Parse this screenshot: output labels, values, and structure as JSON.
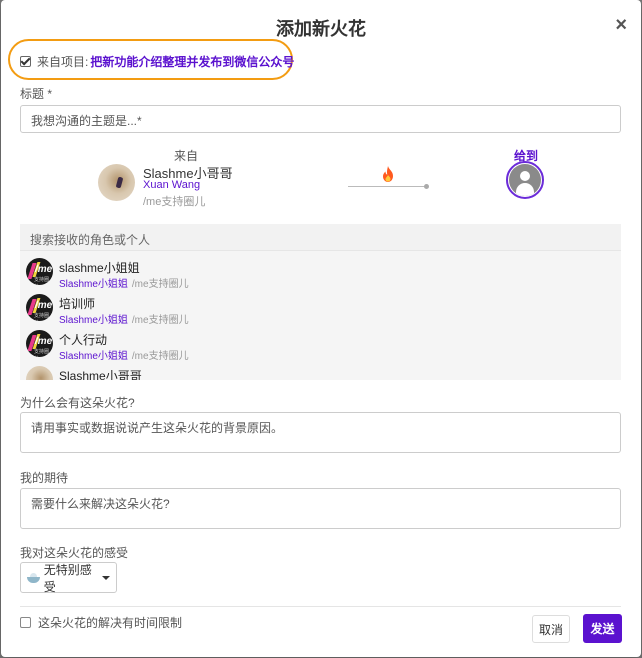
{
  "modal": {
    "title": "添加新火花",
    "close_glyph": "×"
  },
  "from_project": {
    "checked": true,
    "label": "来自项目:",
    "project_name": "把新功能介绍整理并发布到微信公众号"
  },
  "title_field": {
    "label": "标题 *",
    "placeholder": "我想沟通的主题是...*"
  },
  "sender": {
    "header": "来自",
    "name": "Slashme小哥哥",
    "user": "Xuan Wang",
    "circle": "/me支持圈儿"
  },
  "recipient": {
    "header": "给到"
  },
  "search": {
    "label": "搜索接收的角色或个人",
    "results": [
      {
        "name": "slashme小姐姐",
        "user": "Slashme小姐姐",
        "circle": "/me支持圈儿",
        "avatar": "me-logo"
      },
      {
        "name": "培训师",
        "user": "Slashme小姐姐",
        "circle": "/me支持圈儿",
        "avatar": "me-logo"
      },
      {
        "name": "个人行动",
        "user": "Slashme小姐姐",
        "circle": "/me支持圈儿",
        "avatar": "me-logo"
      },
      {
        "name": "Slashme小哥哥",
        "user": "",
        "circle": "",
        "avatar": "photo"
      }
    ]
  },
  "reason": {
    "label": "为什么会有这朵火花?",
    "placeholder": "请用事实或数据说说产生这朵火花的背景原因。"
  },
  "expectation": {
    "label": "我的期待",
    "placeholder": "需要什么来解决这朵火花?"
  },
  "feeling": {
    "label": "我对这朵火花的感受",
    "selected": "无特别感受",
    "icon": "bowl-icon"
  },
  "time_limit": {
    "checked": false,
    "label": "这朵火花的解决有时间限制"
  },
  "actions": {
    "cancel": "取消",
    "send": "发送"
  },
  "colors": {
    "accent": "#5b12cf",
    "highlight_ring": "#f39c12",
    "fire": "#ff5a1f"
  }
}
